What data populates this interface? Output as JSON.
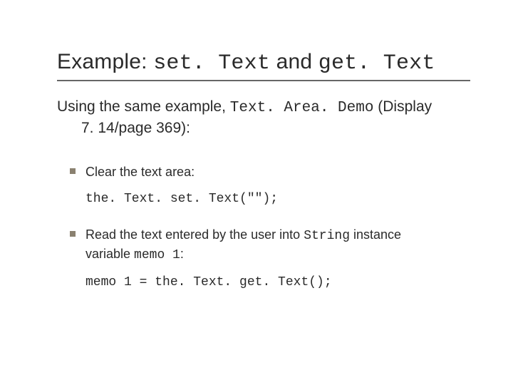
{
  "title": {
    "prefix": "Example: ",
    "code1": "set. Text",
    "mid": " and ",
    "code2": "get. Text"
  },
  "lead": {
    "l1a": "Using the same example, ",
    "l1code": "Text. Area. Demo",
    "l1b": " (Display",
    "l2": "7. 14/page 369):"
  },
  "items": [
    {
      "text": "Clear the text area:",
      "code": "the. Text. set. Text(\"\");"
    },
    {
      "pre": "Read the text entered by the user into ",
      "code_inline1": "String",
      "mid": " instance",
      "line2a": "variable ",
      "code_inline2": "memo 1",
      "line2b": ":",
      "code": "memo 1 = the. Text. get. Text();"
    }
  ]
}
